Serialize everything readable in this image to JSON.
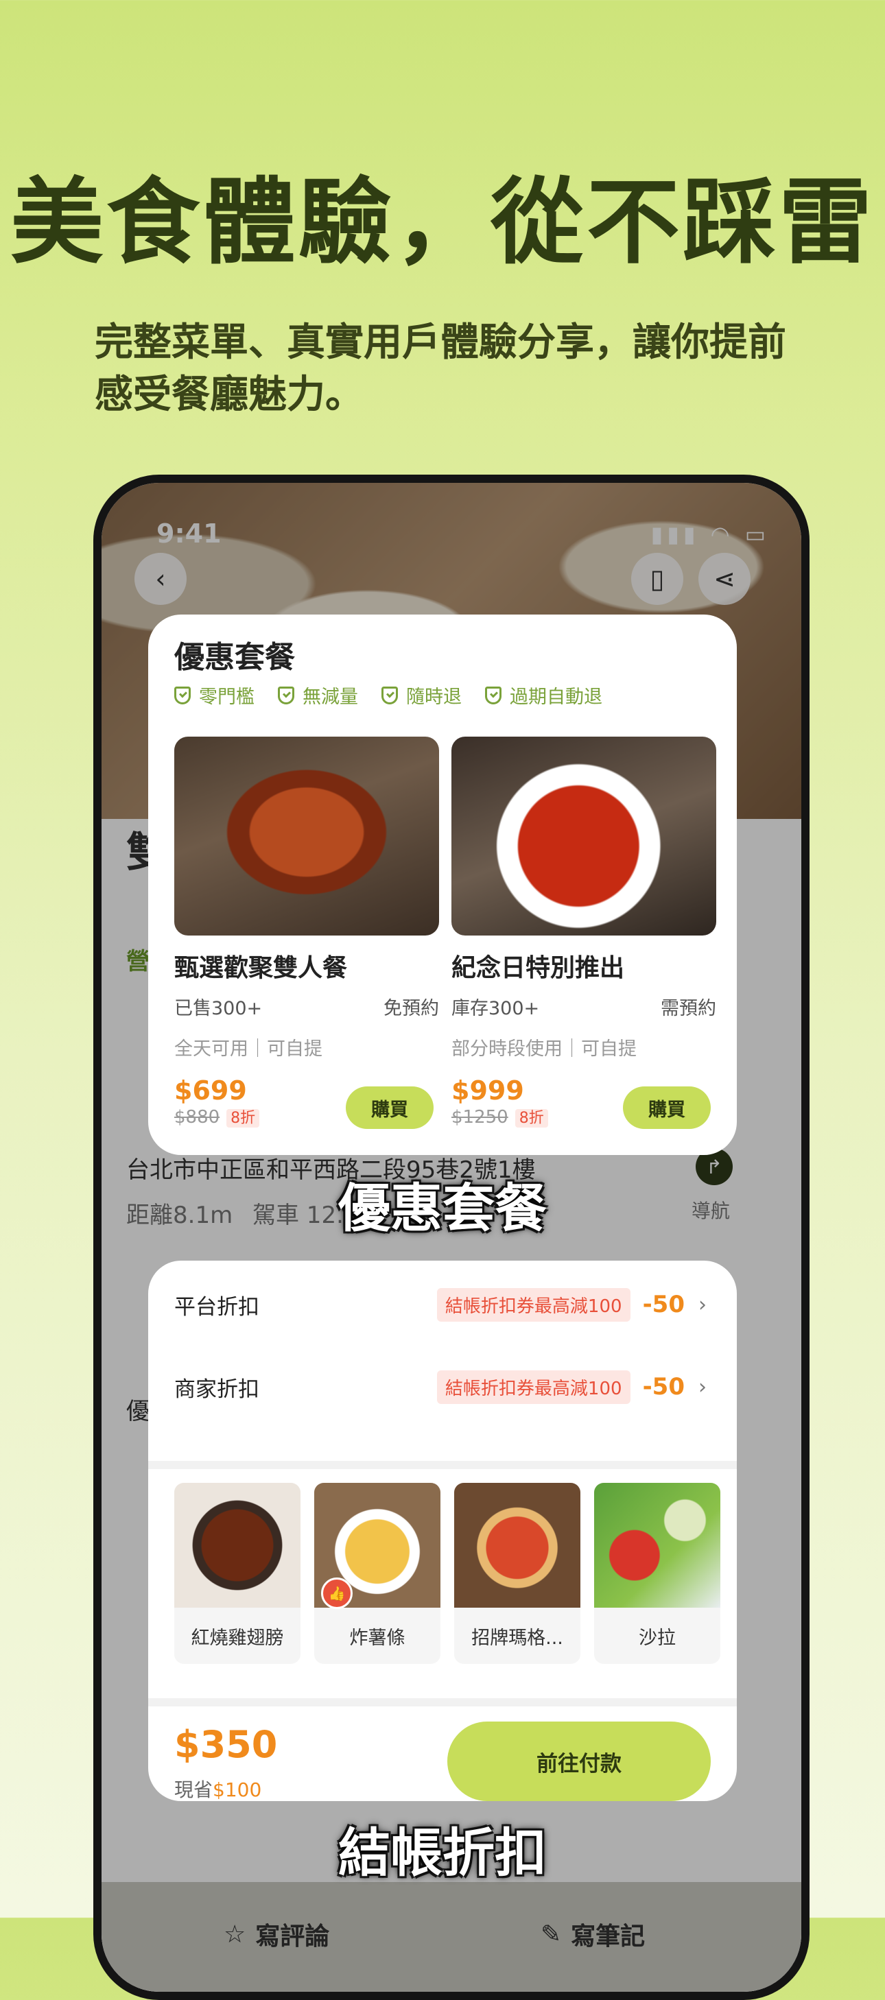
{
  "headline": "美食體驗，從不踩雷",
  "subline": "完整菜單、真實用戶體驗分享，讓你提前感受餐廳魅力。",
  "status": {
    "time": "9:41"
  },
  "restaurant": {
    "name_partial": "雙",
    "address": "台北市中正區和平西路二段95巷2號1樓",
    "distance": "距離8.1m",
    "drive": "駕車 12...",
    "nav_label": "導航",
    "hours_partial": "營",
    "section_partial": "優"
  },
  "deals_card": {
    "title": "優惠套餐",
    "tags": [
      "零門檻",
      "無減量",
      "隨時退",
      "過期自動退"
    ],
    "items": [
      {
        "name": "甄選歡聚雙人餐",
        "sold": "已售300+",
        "booking": "免預約",
        "note": "全天可用｜可自提",
        "price": "$699",
        "original": "$880",
        "discount": "8折",
        "buy": "購買"
      },
      {
        "name": "紀念日特別推出",
        "sold": "庫存300+",
        "booking": "需預約",
        "note": "部分時段使用｜可自提",
        "price": "$999",
        "original": "$1250",
        "discount": "8折",
        "buy": "購買"
      }
    ]
  },
  "caption1": "優惠套餐",
  "checkout_card": {
    "rows": [
      {
        "label": "平台折扣",
        "coupon": "結帳折扣券最高減100",
        "amount": "-50"
      },
      {
        "label": "商家折扣",
        "coupon": "結帳折扣券最高減100",
        "amount": "-50"
      }
    ],
    "items": [
      "紅燒雞翅膀",
      "炸薯條",
      "招牌瑪格...",
      "沙拉"
    ],
    "total": "$350",
    "save_prefix": "現省",
    "save_amount": "$100",
    "pay_label": "前往付款"
  },
  "caption2": "結帳折扣",
  "tabbar": {
    "review": "寫評論",
    "notes": "寫筆記"
  },
  "colors": {
    "accent": "#c7dd5a",
    "price": "#f08a1c",
    "tag": "#7aa23a",
    "headline": "#2f3d12"
  }
}
